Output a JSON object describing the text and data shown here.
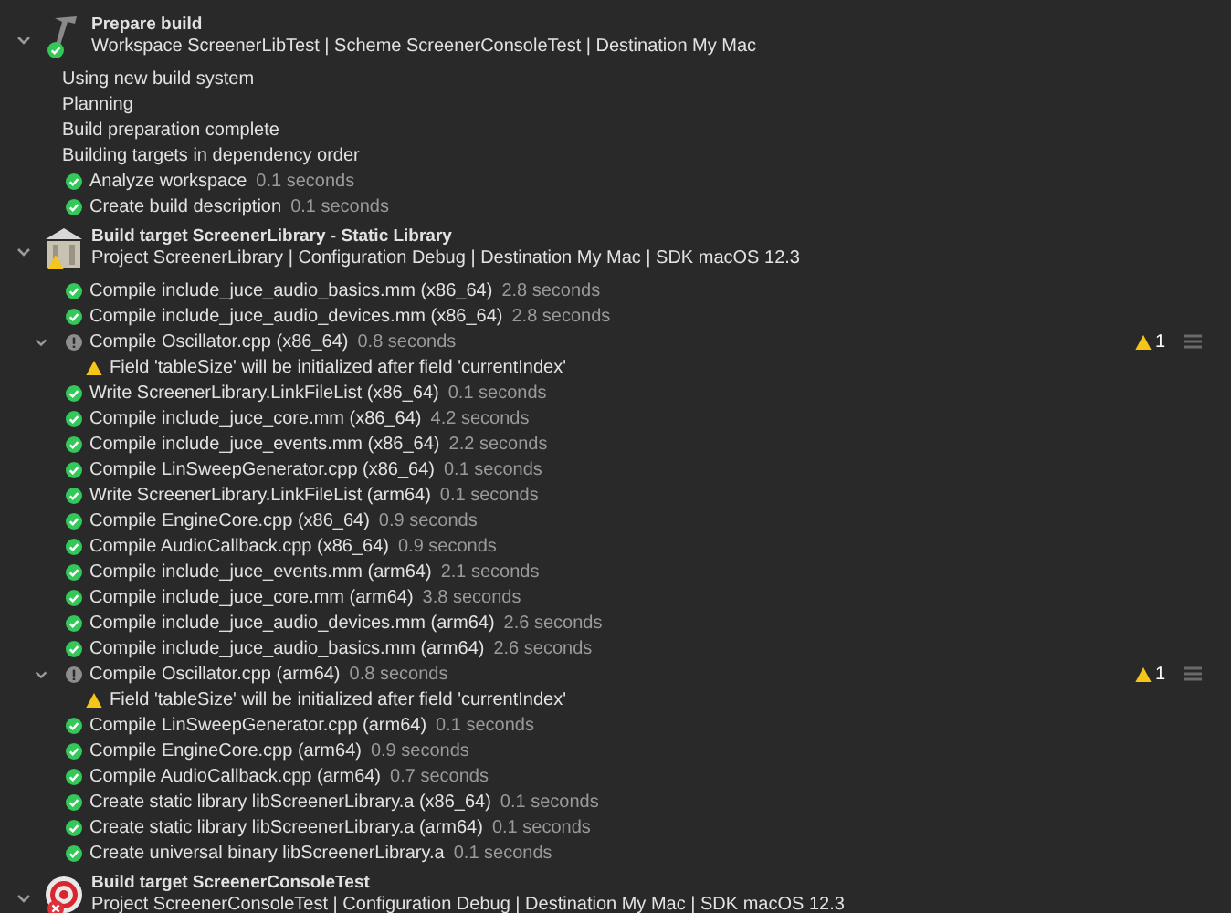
{
  "sections": [
    {
      "kind": "prepare",
      "expanded": true,
      "title": "Prepare build",
      "subtitle": "Workspace ScreenerLibTest | Scheme ScreenerConsoleTest | Destination My Mac",
      "items": [
        {
          "kind": "message",
          "text": "Using new build system"
        },
        {
          "kind": "message",
          "text": "Planning"
        },
        {
          "kind": "message",
          "text": "Build preparation complete"
        },
        {
          "kind": "message",
          "text": "Building targets in dependency order"
        },
        {
          "kind": "success",
          "text": "Analyze workspace",
          "duration": "0.1 seconds"
        },
        {
          "kind": "success",
          "text": "Create build description",
          "duration": "0.1 seconds"
        }
      ]
    },
    {
      "kind": "library",
      "expanded": true,
      "title": "Build target ScreenerLibrary - Static Library",
      "subtitle": "Project ScreenerLibrary | Configuration Debug | Destination My Mac | SDK macOS 12.3",
      "items": [
        {
          "kind": "success",
          "text": "Compile include_juce_audio_basics.mm (x86_64)",
          "duration": "2.8 seconds"
        },
        {
          "kind": "success",
          "text": "Compile include_juce_audio_devices.mm (x86_64)",
          "duration": "2.8 seconds"
        },
        {
          "kind": "notice",
          "expanded": true,
          "badge": "1",
          "text": "Compile Oscillator.cpp (x86_64)",
          "duration": "0.8 seconds",
          "children": [
            {
              "kind": "warning",
              "text": "Field 'tableSize' will be initialized after field 'currentIndex'"
            }
          ]
        },
        {
          "kind": "success",
          "text": "Write ScreenerLibrary.LinkFileList (x86_64)",
          "duration": "0.1 seconds"
        },
        {
          "kind": "success",
          "text": "Compile include_juce_core.mm (x86_64)",
          "duration": "4.2 seconds"
        },
        {
          "kind": "success",
          "text": "Compile include_juce_events.mm (x86_64)",
          "duration": "2.2 seconds"
        },
        {
          "kind": "success",
          "text": "Compile LinSweepGenerator.cpp (x86_64)",
          "duration": "0.1 seconds"
        },
        {
          "kind": "success",
          "text": "Write ScreenerLibrary.LinkFileList (arm64)",
          "duration": "0.1 seconds"
        },
        {
          "kind": "success",
          "text": "Compile EngineCore.cpp (x86_64)",
          "duration": "0.9 seconds"
        },
        {
          "kind": "success",
          "text": "Compile AudioCallback.cpp (x86_64)",
          "duration": "0.9 seconds"
        },
        {
          "kind": "success",
          "text": "Compile include_juce_events.mm (arm64)",
          "duration": "2.1 seconds"
        },
        {
          "kind": "success",
          "text": "Compile include_juce_core.mm (arm64)",
          "duration": "3.8 seconds"
        },
        {
          "kind": "success",
          "text": "Compile include_juce_audio_devices.mm (arm64)",
          "duration": "2.6 seconds"
        },
        {
          "kind": "success",
          "text": "Compile include_juce_audio_basics.mm (arm64)",
          "duration": "2.6 seconds"
        },
        {
          "kind": "notice",
          "expanded": true,
          "badge": "1",
          "text": "Compile Oscillator.cpp (arm64)",
          "duration": "0.8 seconds",
          "children": [
            {
              "kind": "warning",
              "text": "Field 'tableSize' will be initialized after field 'currentIndex'"
            }
          ]
        },
        {
          "kind": "success",
          "text": "Compile LinSweepGenerator.cpp (arm64)",
          "duration": "0.1 seconds"
        },
        {
          "kind": "success",
          "text": "Compile EngineCore.cpp (arm64)",
          "duration": "0.9 seconds"
        },
        {
          "kind": "success",
          "text": "Compile AudioCallback.cpp (arm64)",
          "duration": "0.7 seconds"
        },
        {
          "kind": "success",
          "text": "Create static library libScreenerLibrary.a (x86_64)",
          "duration": "0.1 seconds"
        },
        {
          "kind": "success",
          "text": "Create static library libScreenerLibrary.a (arm64)",
          "duration": "0.1 seconds"
        },
        {
          "kind": "success",
          "text": "Create universal binary libScreenerLibrary.a",
          "duration": "0.1 seconds"
        }
      ]
    },
    {
      "kind": "target",
      "expanded": true,
      "title": "Build target ScreenerConsoleTest",
      "subtitle": "Project ScreenerConsoleTest | Configuration Debug | Destination My Mac | SDK macOS 12.3"
    }
  ]
}
